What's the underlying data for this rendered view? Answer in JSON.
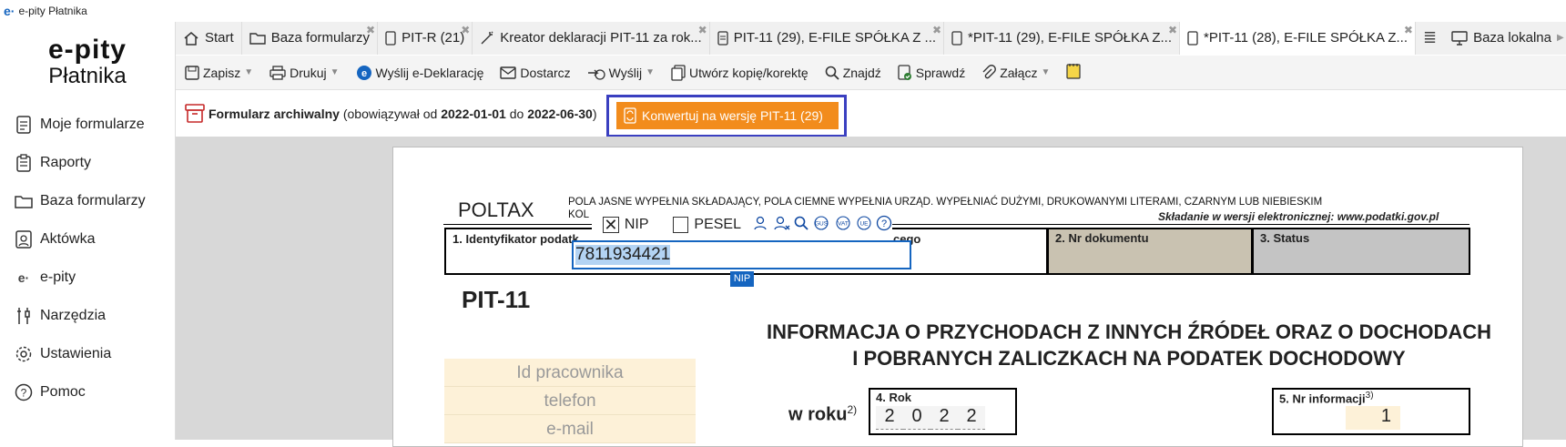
{
  "window": {
    "title": "e-pity Płatnika"
  },
  "sidebar": {
    "brand_line1": "e-pity",
    "brand_line2": "Płatnika",
    "items": [
      {
        "label": "Moje formularze",
        "icon": "document-icon"
      },
      {
        "label": "Raporty",
        "icon": "clipboard-icon"
      },
      {
        "label": "Baza formularzy",
        "icon": "folder-icon"
      },
      {
        "label": "Aktówka",
        "icon": "briefcase-icon"
      },
      {
        "label": "e-pity",
        "icon": "epity-logo-icon"
      },
      {
        "label": "Narzędzia",
        "icon": "tools-icon"
      },
      {
        "label": "Ustawienia",
        "icon": "gear-icon"
      },
      {
        "label": "Pomoc",
        "icon": "help-icon"
      }
    ]
  },
  "tabs": [
    {
      "label": "Start",
      "icon": "home-icon"
    },
    {
      "label": "Baza formularzy",
      "icon": "folder-icon"
    },
    {
      "label": "PIT-R (21)",
      "icon": "document-icon"
    },
    {
      "label": "Kreator deklaracji PIT-11 za rok...",
      "icon": "wand-icon"
    },
    {
      "label": "PIT-11 (29), E-FILE SPÓŁKA Z ...",
      "icon": "document-icon"
    },
    {
      "label": "*PIT-11 (29), E-FILE SPÓŁKA Z...",
      "icon": "document-icon"
    },
    {
      "label": "*PIT-11 (28), E-FILE SPÓŁKA Z...",
      "icon": "document-icon"
    }
  ],
  "tabs_right": {
    "local_db": "Baza lokalna"
  },
  "toolbar": {
    "save": "Zapisz",
    "print": "Drukuj",
    "send_edecl": "Wyślij e-Deklarację",
    "deliver": "Dostarcz",
    "send": "Wyślij",
    "copy": "Utwórz kopię/korektę",
    "find": "Znajdź",
    "check": "Sprawdź",
    "attach": "Załącz"
  },
  "archive": {
    "label": "Formularz archiwalny",
    "valid_prefix": "(obowiązywał od ",
    "from": "2022-01-01",
    "mid": " do ",
    "to": "2022-06-30",
    "suffix": ")",
    "convert_button": "Konwertuj na wersję PIT-11 (29)"
  },
  "form": {
    "poltax": "POLTAX",
    "instructions": "POLA JASNE WYPEŁNIA SKŁADAJĄCY, POLA CIEMNE WYPEŁNIA URZĄD. WYPEŁNIAĆ DUŻYMI, DRUKOWANYMI LITERAMI, CZARNYM LUB NIEBIESKIM",
    "instructions2": "KOL",
    "efile": "Składanie w wersji elektronicznej: www.podatki.gov.pl",
    "box1_label": "1. Identyfikator podatk",
    "box1_label_end": "cego",
    "box2_label": "2. Nr dokumentu",
    "box3_label": "3. Status",
    "nip_option": "NIP",
    "pesel_option": "PESEL",
    "nip_value": "7811934421",
    "nip_tag": "NIP",
    "pit_title": "PIT-11",
    "heading1": "INFORMACJA O PRZYCHODACH Z INNYCH ŹRÓDEŁ ORAZ O DOCHODACH",
    "heading2": "I POBRANYCH ZALICZKACH NA PODATEK DOCHODOWY",
    "side_fields": [
      "Id pracownika",
      "telefon",
      "e-mail"
    ],
    "w_roku": "w roku",
    "w_roku_sup": "2)",
    "rok_label": "4. Rok",
    "rok_digits": [
      "2",
      "0",
      "2",
      "2"
    ],
    "nr_label": "5. Nr informacji",
    "nr_sup": "3)",
    "nr_value": "1"
  }
}
